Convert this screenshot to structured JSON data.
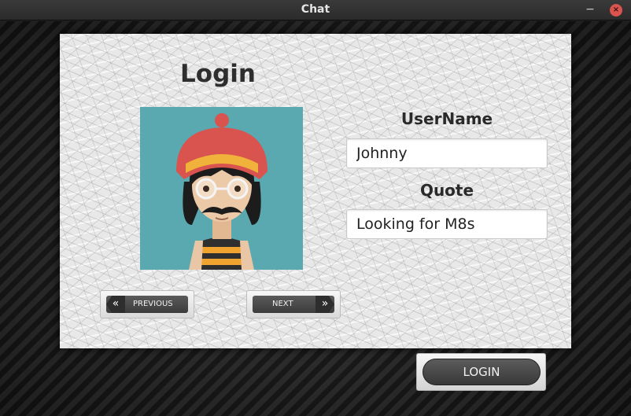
{
  "window": {
    "title": "Chat",
    "minimize_glyph": "−",
    "close_glyph": "×"
  },
  "card": {
    "title": "Login",
    "previous_label": "PREVIOUS",
    "next_label": "NEXT",
    "prev_icon": "«",
    "next_icon": "»"
  },
  "form": {
    "username_label": "UserName",
    "username_value": "Johnny",
    "quote_label": "Quote",
    "quote_value": "Looking for M8s"
  },
  "login_button": "LOGIN",
  "colors": {
    "avatar_bg": "#5aa8b0",
    "close_button": "#d9534f"
  }
}
